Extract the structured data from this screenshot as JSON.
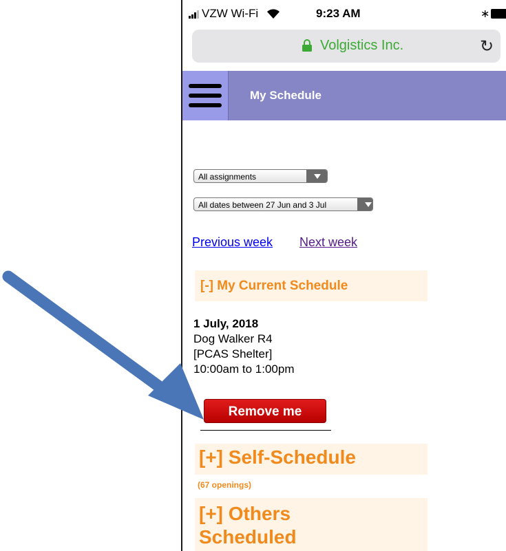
{
  "status_bar": {
    "carrier": "VZW Wi-Fi",
    "time": "9:23 AM"
  },
  "browser": {
    "site_name": "Volgistics Inc."
  },
  "app_bar": {
    "title": "My Schedule"
  },
  "filters": {
    "assignments_selected": "All assignments",
    "dates_selected": "All dates between 27 Jun and 3 Jul"
  },
  "week_nav": {
    "previous_label": "Previous week",
    "next_label": "Next week"
  },
  "current_schedule": {
    "header": "[-] My Current Schedule",
    "entry": {
      "date": "1 July, 2018",
      "assignment": "Dog Walker R4",
      "location": "[PCAS Shelter]",
      "time": "10:00am to 1:00pm"
    },
    "remove_label": "Remove me"
  },
  "self_schedule": {
    "header": "[+] Self-Schedule",
    "count": "(67 openings)"
  },
  "others_scheduled": {
    "line1": "[+] Others",
    "line2": "Scheduled"
  },
  "colors": {
    "app_bar": "#8686c6",
    "menu_button": "#9a9be8",
    "section_header_bg": "#fff4e6",
    "section_header_text": "#f08a1c",
    "remove_button": "#cc0000",
    "link": "#0000ee",
    "visited_link": "#551a8b",
    "annotation_arrow": "#4a76b7"
  },
  "icons": {
    "signal": "signal-bars-icon",
    "wifi": "wifi-icon",
    "bluetooth": "bluetooth-icon",
    "battery": "battery-icon",
    "lock": "lock-icon",
    "reload": "reload-icon",
    "menu": "hamburger-menu-icon",
    "pointer": "annotation-arrow-icon"
  }
}
